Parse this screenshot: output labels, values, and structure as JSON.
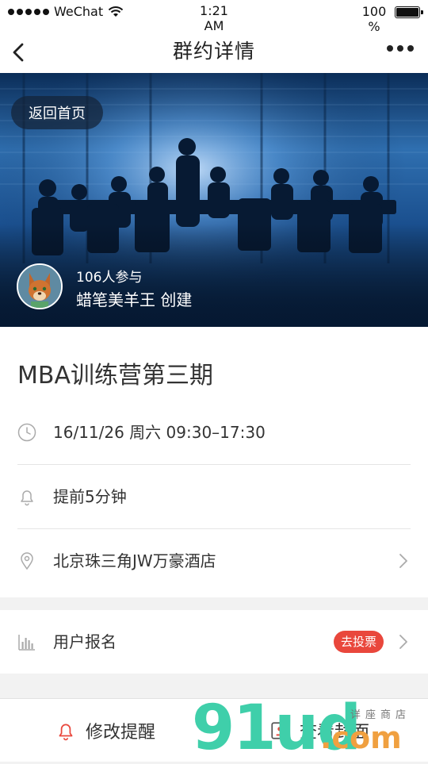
{
  "status_bar": {
    "carrier": "WeChat",
    "time": "1:21 AM",
    "battery_percent": "100 %",
    "signal_bars": 5
  },
  "nav": {
    "title": "群约详情",
    "back_icon": "chevron-left-icon",
    "more_icon": "more-dots-icon"
  },
  "banner": {
    "home_button": "返回首页",
    "participants": "106人参与",
    "creator": "蜡笔美羊王 创建",
    "avatar_icon": "fox-avatar"
  },
  "event": {
    "title": "MBA训练营第三期"
  },
  "details": {
    "datetime": "16/11/26 周六 09:30–17:30",
    "reminder": "提前5分钟",
    "location": "北京珠三角JW万豪酒店"
  },
  "signup": {
    "label": "用户报名",
    "badge": "去投票"
  },
  "bottom_bar": {
    "edit_reminder": "修改提醒",
    "view_cover": "查看封面"
  },
  "watermark": {
    "main": "91ud",
    "suffix": ".com",
    "small": "详座商店"
  },
  "colors": {
    "accent_red": "#e9473c",
    "watermark_green": "#3fcfaa",
    "watermark_orange": "#f0a040"
  }
}
